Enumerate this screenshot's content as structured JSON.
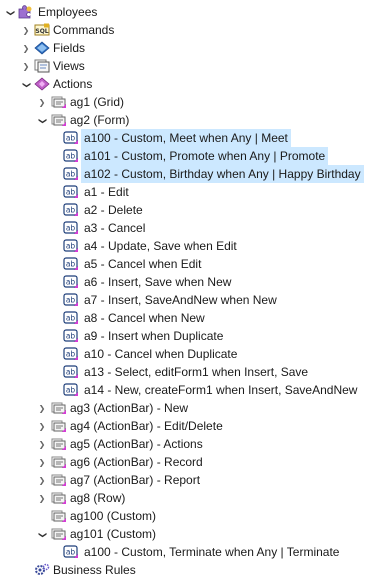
{
  "tree": [
    {
      "label": "Employees",
      "level": 0,
      "toggle": "open",
      "icon": "puzzle-root-icon",
      "name": "employees"
    },
    {
      "label": "Commands",
      "level": 1,
      "toggle": "closed",
      "icon": "sql-commands-icon",
      "name": "commands"
    },
    {
      "label": "Fields",
      "level": 1,
      "toggle": "closed",
      "icon": "fields-icon",
      "name": "fields"
    },
    {
      "label": "Views",
      "level": 1,
      "toggle": "closed",
      "icon": "views-icon",
      "name": "views"
    },
    {
      "label": "Actions",
      "level": 1,
      "toggle": "open",
      "icon": "actions-icon",
      "name": "actions"
    },
    {
      "label": "ag1 (Grid)",
      "level": 2,
      "toggle": "closed",
      "icon": "action-group-icon",
      "name": "ag1"
    },
    {
      "label": "ag2 (Form)",
      "level": 2,
      "toggle": "open",
      "icon": "action-group-icon",
      "name": "ag2"
    },
    {
      "label": "a100 - Custom, Meet when Any | Meet",
      "level": 3,
      "toggle": "none",
      "icon": "action-ab-icon",
      "selected": true,
      "name": "a100"
    },
    {
      "label": "a101 - Custom, Promote when Any | Promote",
      "level": 3,
      "toggle": "none",
      "icon": "action-ab-icon",
      "selected": true,
      "name": "a101"
    },
    {
      "label": "a102 - Custom, Birthday when Any | Happy Birthday",
      "level": 3,
      "toggle": "none",
      "icon": "action-ab-icon",
      "selected": true,
      "name": "a102"
    },
    {
      "label": "a1 - Edit",
      "level": 3,
      "toggle": "none",
      "icon": "action-ab-icon",
      "name": "a1"
    },
    {
      "label": "a2 - Delete",
      "level": 3,
      "toggle": "none",
      "icon": "action-ab-icon",
      "name": "a2"
    },
    {
      "label": "a3 - Cancel",
      "level": 3,
      "toggle": "none",
      "icon": "action-ab-icon",
      "name": "a3"
    },
    {
      "label": "a4 - Update, Save when Edit",
      "level": 3,
      "toggle": "none",
      "icon": "action-ab-icon",
      "name": "a4"
    },
    {
      "label": "a5 - Cancel when Edit",
      "level": 3,
      "toggle": "none",
      "icon": "action-ab-icon",
      "name": "a5"
    },
    {
      "label": "a6 - Insert, Save when New",
      "level": 3,
      "toggle": "none",
      "icon": "action-ab-icon",
      "name": "a6"
    },
    {
      "label": "a7 - Insert, SaveAndNew when New",
      "level": 3,
      "toggle": "none",
      "icon": "action-ab-icon",
      "name": "a7"
    },
    {
      "label": "a8 - Cancel when New",
      "level": 3,
      "toggle": "none",
      "icon": "action-ab-icon",
      "name": "a8"
    },
    {
      "label": "a9 - Insert when Duplicate",
      "level": 3,
      "toggle": "none",
      "icon": "action-ab-icon",
      "name": "a9"
    },
    {
      "label": "a10 - Cancel when Duplicate",
      "level": 3,
      "toggle": "none",
      "icon": "action-ab-icon",
      "name": "a10"
    },
    {
      "label": "a13 - Select, editForm1 when Insert, Save",
      "level": 3,
      "toggle": "none",
      "icon": "action-ab-icon",
      "name": "a13"
    },
    {
      "label": "a14 - New, createForm1 when Insert, SaveAndNew",
      "level": 3,
      "toggle": "none",
      "icon": "action-ab-icon",
      "name": "a14"
    },
    {
      "label": "ag3 (ActionBar) - New",
      "level": 2,
      "toggle": "closed",
      "icon": "action-group-icon",
      "name": "ag3"
    },
    {
      "label": "ag4 (ActionBar) - Edit/Delete",
      "level": 2,
      "toggle": "closed",
      "icon": "action-group-icon",
      "name": "ag4"
    },
    {
      "label": "ag5 (ActionBar) - Actions",
      "level": 2,
      "toggle": "closed",
      "icon": "action-group-icon",
      "name": "ag5"
    },
    {
      "label": "ag6 (ActionBar) - Record",
      "level": 2,
      "toggle": "closed",
      "icon": "action-group-icon",
      "name": "ag6"
    },
    {
      "label": "ag7 (ActionBar) - Report",
      "level": 2,
      "toggle": "closed",
      "icon": "action-group-icon",
      "name": "ag7"
    },
    {
      "label": "ag8 (Row)",
      "level": 2,
      "toggle": "closed",
      "icon": "action-group-icon",
      "name": "ag8"
    },
    {
      "label": "ag100 (Custom)",
      "level": 2,
      "toggle": "none",
      "icon": "action-group-icon",
      "name": "ag100"
    },
    {
      "label": "ag101 (Custom)",
      "level": 2,
      "toggle": "open",
      "icon": "action-group-icon",
      "name": "ag101"
    },
    {
      "label": "a100 - Custom, Terminate when Any | Terminate",
      "level": 3,
      "toggle": "none",
      "icon": "action-ab-icon",
      "name": "ag101-a100"
    },
    {
      "label": "Business Rules",
      "level": 1,
      "toggle": "none",
      "icon": "business-rules-icon",
      "name": "business-rules"
    }
  ],
  "colors": {
    "selection": "#cce8ff",
    "ab_icon_border": "#1f3f7a",
    "ab_icon_accent": "#d63bd6",
    "actions_icon": "#c060c8",
    "fields_icon": "#2f6fc0",
    "group_icon": "#8a8a8a"
  }
}
